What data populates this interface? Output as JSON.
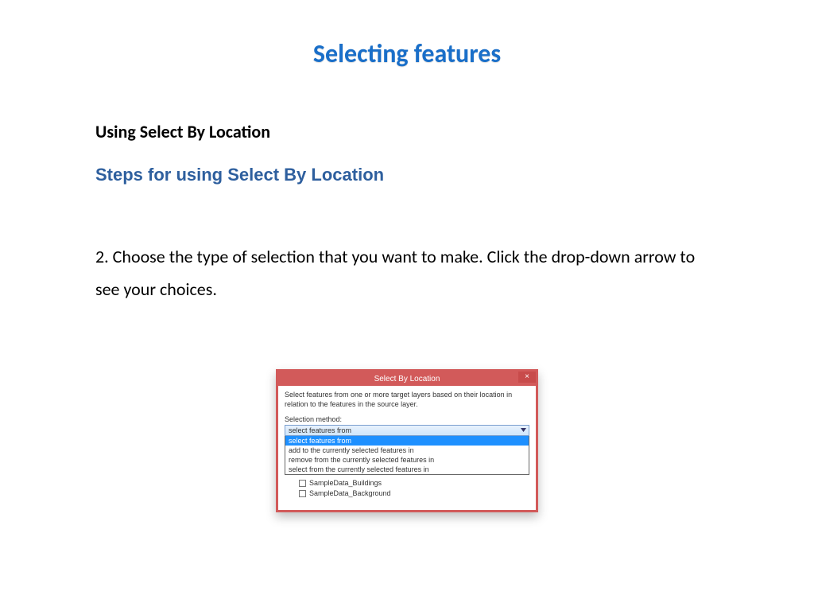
{
  "title": "Selecting features",
  "section_heading": "Using Select By Location",
  "subheading": "Steps for using Select By Location",
  "body_text": "2. Choose the type of selection that you want to  make. Click the drop-down arrow to see your choices.",
  "dialog": {
    "title": "Select By Location",
    "close_glyph": "×",
    "description": "Select features from one or more target layers based on their location in relation to the features in the source layer.",
    "label_method": "Selection method:",
    "combo_selected": "select features from",
    "options": [
      "select features from",
      "add to the currently selected features in",
      "remove from the currently selected features in",
      "select from the currently selected features in"
    ],
    "layers": [
      "SampleData_Buildings",
      "SampleData_Background"
    ]
  }
}
